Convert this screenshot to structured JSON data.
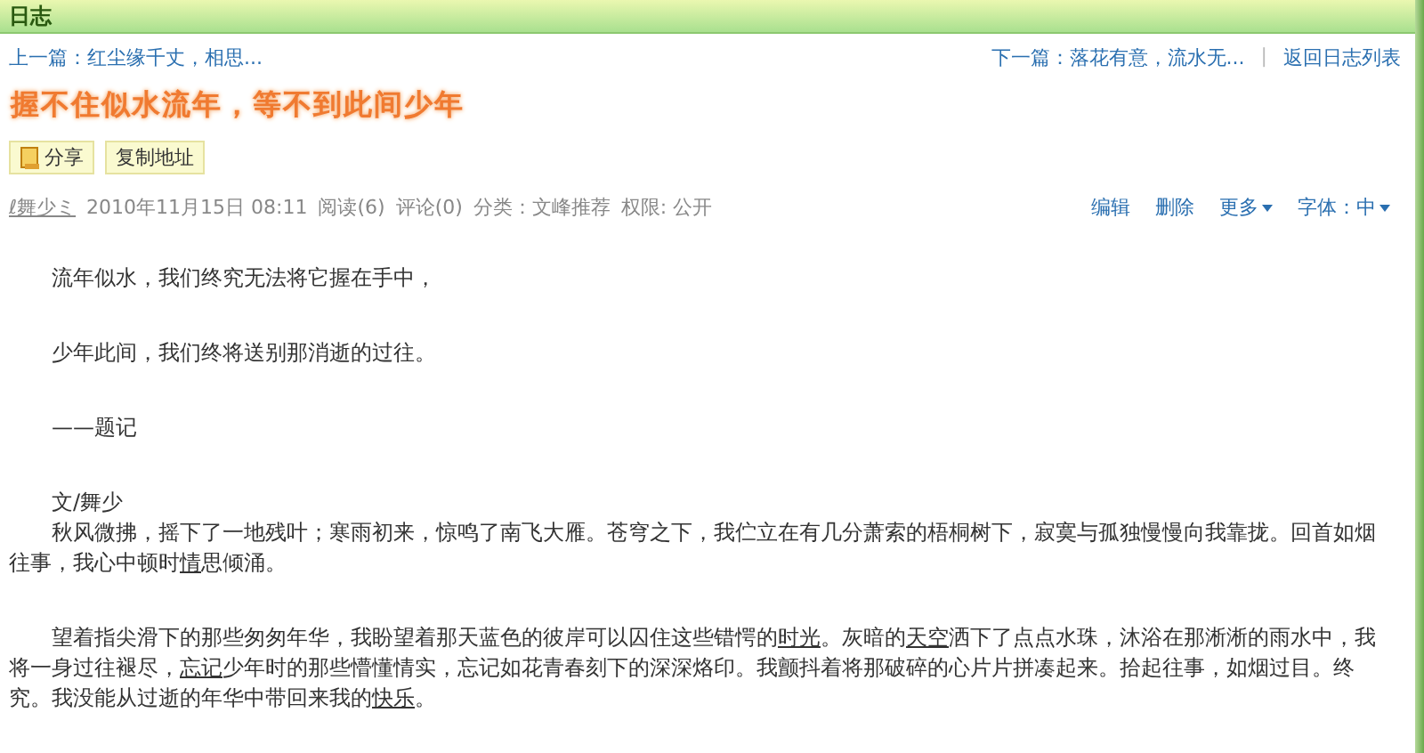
{
  "header": {
    "title": "日志"
  },
  "nav": {
    "previous": "上一篇：红尘缘千丈，相思...",
    "next": "下一篇：落花有意，流水无...",
    "separator": "|",
    "back": "返回日志列表"
  },
  "post": {
    "title": "握不住似水流年，等不到此间少年",
    "buttons": [
      {
        "label": "分享",
        "kind": "share"
      },
      {
        "label": "复制地址",
        "kind": "plain"
      }
    ],
    "meta": {
      "author": "ℓ舞少ミ",
      "date": "2010年11月15日 08:11",
      "reads": "阅读(6)",
      "comments": "评论(0)",
      "category": "分类：文峰推荐",
      "permission": "权限: 公开"
    },
    "actions": [
      {
        "label": "编辑",
        "dropdown": false
      },
      {
        "label": "删除",
        "dropdown": false
      },
      {
        "label": "更多",
        "dropdown": true
      },
      {
        "label": "字体：中",
        "dropdown": true
      }
    ],
    "sections": [
      [
        [
          {
            "text": "流年似水，我们终究无法将它握在手中，",
            "link": false
          }
        ]
      ],
      [
        [
          {
            "text": "少年此间，我们终将送别那消逝的过往。",
            "link": false
          }
        ]
      ],
      [
        [
          {
            "text": "——题记",
            "link": false
          }
        ]
      ],
      [
        [
          {
            "text": "文/舞少",
            "link": false
          }
        ],
        [
          {
            "text": "秋风微拂，摇下了一地残叶；寒雨初来，惊鸣了南飞大雁。苍穹之下，我伫立在有几分萧索的梧桐树下，寂寞与孤独慢慢向我靠拢。回首如烟往事，我心中顿时",
            "link": false
          },
          {
            "text": "情",
            "link": true
          },
          {
            "text": "思倾涌。",
            "link": false
          }
        ]
      ],
      [
        [
          {
            "text": "望着指尖滑下的那些匆匆年华，我盼望着那天蓝色的彼岸可以囚住这些错愕的",
            "link": false
          },
          {
            "text": "时光",
            "link": true
          },
          {
            "text": "。灰暗的",
            "link": false
          },
          {
            "text": "天空",
            "link": true
          },
          {
            "text": "洒下了点点水珠，沐浴在那淅淅的雨水中，我将一身过往褪尽，",
            "link": false
          },
          {
            "text": "忘记",
            "link": true
          },
          {
            "text": "少年时的那些懵懂情实，忘记如花青春刻下的深深烙印。我颤抖着将那破碎的心片片拼凑起来。拾起往事，如烟过目。终究。我没能从过逝的年华中带回来我的",
            "link": false
          },
          {
            "text": "快乐",
            "link": true
          },
          {
            "text": "。",
            "link": false
          }
        ]
      ]
    ]
  }
}
